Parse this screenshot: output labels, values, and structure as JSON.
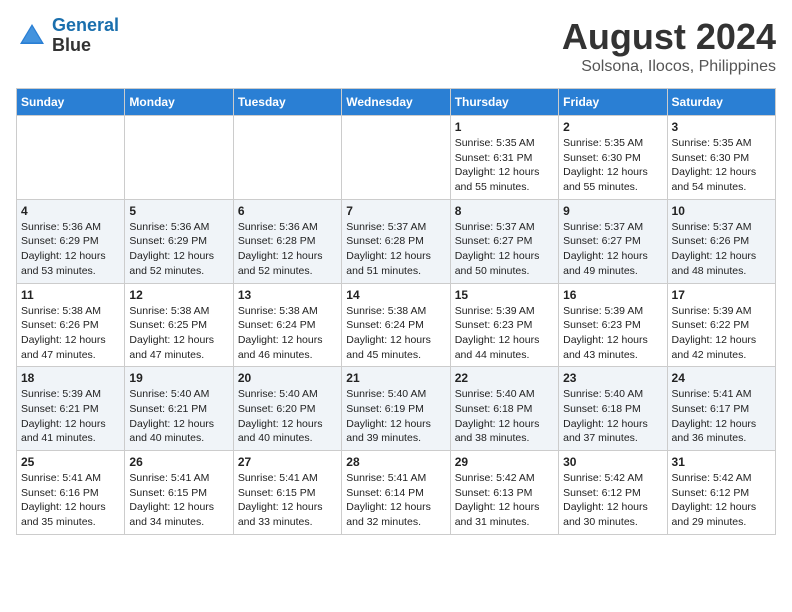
{
  "logo": {
    "line1": "General",
    "line2": "Blue"
  },
  "title": "August 2024",
  "subtitle": "Solsona, Ilocos, Philippines",
  "days_of_week": [
    "Sunday",
    "Monday",
    "Tuesday",
    "Wednesday",
    "Thursday",
    "Friday",
    "Saturday"
  ],
  "weeks": [
    [
      {
        "day": "",
        "info": ""
      },
      {
        "day": "",
        "info": ""
      },
      {
        "day": "",
        "info": ""
      },
      {
        "day": "",
        "info": ""
      },
      {
        "day": "1",
        "info": "Sunrise: 5:35 AM\nSunset: 6:31 PM\nDaylight: 12 hours\nand 55 minutes."
      },
      {
        "day": "2",
        "info": "Sunrise: 5:35 AM\nSunset: 6:30 PM\nDaylight: 12 hours\nand 55 minutes."
      },
      {
        "day": "3",
        "info": "Sunrise: 5:35 AM\nSunset: 6:30 PM\nDaylight: 12 hours\nand 54 minutes."
      }
    ],
    [
      {
        "day": "4",
        "info": "Sunrise: 5:36 AM\nSunset: 6:29 PM\nDaylight: 12 hours\nand 53 minutes."
      },
      {
        "day": "5",
        "info": "Sunrise: 5:36 AM\nSunset: 6:29 PM\nDaylight: 12 hours\nand 52 minutes."
      },
      {
        "day": "6",
        "info": "Sunrise: 5:36 AM\nSunset: 6:28 PM\nDaylight: 12 hours\nand 52 minutes."
      },
      {
        "day": "7",
        "info": "Sunrise: 5:37 AM\nSunset: 6:28 PM\nDaylight: 12 hours\nand 51 minutes."
      },
      {
        "day": "8",
        "info": "Sunrise: 5:37 AM\nSunset: 6:27 PM\nDaylight: 12 hours\nand 50 minutes."
      },
      {
        "day": "9",
        "info": "Sunrise: 5:37 AM\nSunset: 6:27 PM\nDaylight: 12 hours\nand 49 minutes."
      },
      {
        "day": "10",
        "info": "Sunrise: 5:37 AM\nSunset: 6:26 PM\nDaylight: 12 hours\nand 48 minutes."
      }
    ],
    [
      {
        "day": "11",
        "info": "Sunrise: 5:38 AM\nSunset: 6:26 PM\nDaylight: 12 hours\nand 47 minutes."
      },
      {
        "day": "12",
        "info": "Sunrise: 5:38 AM\nSunset: 6:25 PM\nDaylight: 12 hours\nand 47 minutes."
      },
      {
        "day": "13",
        "info": "Sunrise: 5:38 AM\nSunset: 6:24 PM\nDaylight: 12 hours\nand 46 minutes."
      },
      {
        "day": "14",
        "info": "Sunrise: 5:38 AM\nSunset: 6:24 PM\nDaylight: 12 hours\nand 45 minutes."
      },
      {
        "day": "15",
        "info": "Sunrise: 5:39 AM\nSunset: 6:23 PM\nDaylight: 12 hours\nand 44 minutes."
      },
      {
        "day": "16",
        "info": "Sunrise: 5:39 AM\nSunset: 6:23 PM\nDaylight: 12 hours\nand 43 minutes."
      },
      {
        "day": "17",
        "info": "Sunrise: 5:39 AM\nSunset: 6:22 PM\nDaylight: 12 hours\nand 42 minutes."
      }
    ],
    [
      {
        "day": "18",
        "info": "Sunrise: 5:39 AM\nSunset: 6:21 PM\nDaylight: 12 hours\nand 41 minutes."
      },
      {
        "day": "19",
        "info": "Sunrise: 5:40 AM\nSunset: 6:21 PM\nDaylight: 12 hours\nand 40 minutes."
      },
      {
        "day": "20",
        "info": "Sunrise: 5:40 AM\nSunset: 6:20 PM\nDaylight: 12 hours\nand 40 minutes."
      },
      {
        "day": "21",
        "info": "Sunrise: 5:40 AM\nSunset: 6:19 PM\nDaylight: 12 hours\nand 39 minutes."
      },
      {
        "day": "22",
        "info": "Sunrise: 5:40 AM\nSunset: 6:18 PM\nDaylight: 12 hours\nand 38 minutes."
      },
      {
        "day": "23",
        "info": "Sunrise: 5:40 AM\nSunset: 6:18 PM\nDaylight: 12 hours\nand 37 minutes."
      },
      {
        "day": "24",
        "info": "Sunrise: 5:41 AM\nSunset: 6:17 PM\nDaylight: 12 hours\nand 36 minutes."
      }
    ],
    [
      {
        "day": "25",
        "info": "Sunrise: 5:41 AM\nSunset: 6:16 PM\nDaylight: 12 hours\nand 35 minutes."
      },
      {
        "day": "26",
        "info": "Sunrise: 5:41 AM\nSunset: 6:15 PM\nDaylight: 12 hours\nand 34 minutes."
      },
      {
        "day": "27",
        "info": "Sunrise: 5:41 AM\nSunset: 6:15 PM\nDaylight: 12 hours\nand 33 minutes."
      },
      {
        "day": "28",
        "info": "Sunrise: 5:41 AM\nSunset: 6:14 PM\nDaylight: 12 hours\nand 32 minutes."
      },
      {
        "day": "29",
        "info": "Sunrise: 5:42 AM\nSunset: 6:13 PM\nDaylight: 12 hours\nand 31 minutes."
      },
      {
        "day": "30",
        "info": "Sunrise: 5:42 AM\nSunset: 6:12 PM\nDaylight: 12 hours\nand 30 minutes."
      },
      {
        "day": "31",
        "info": "Sunrise: 5:42 AM\nSunset: 6:12 PM\nDaylight: 12 hours\nand 29 minutes."
      }
    ]
  ]
}
